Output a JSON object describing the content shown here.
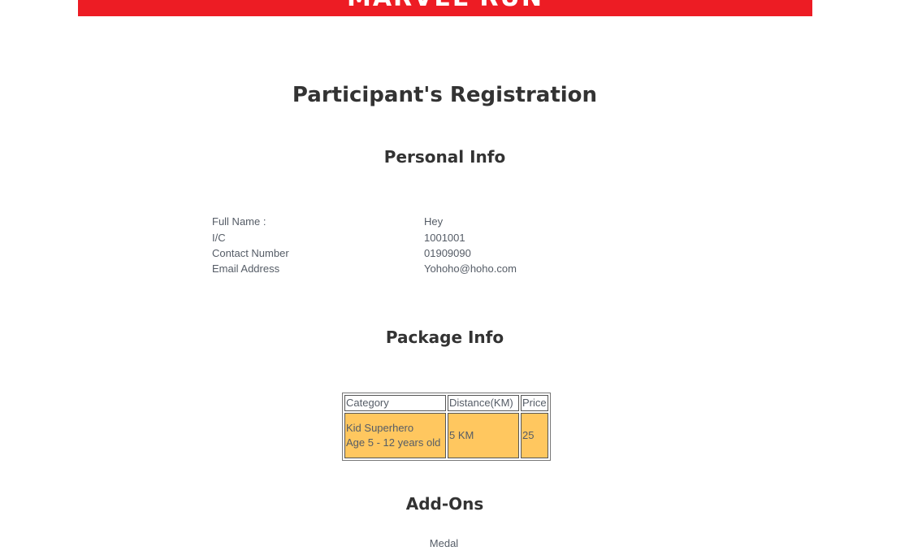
{
  "banner": {
    "logo_text": "MARVEL RUN",
    "color": "#ed1c24"
  },
  "page": {
    "title": "Participant's Registration"
  },
  "personal_info": {
    "heading": "Personal Info",
    "fields": [
      {
        "label": "Full Name :",
        "value": "Hey"
      },
      {
        "label": "I/C",
        "value": "1001001"
      },
      {
        "label": "Contact Number",
        "value": "01909090"
      },
      {
        "label": "Email Address",
        "value": "Yohoho@hoho.com"
      }
    ]
  },
  "package_info": {
    "heading": "Package Info",
    "columns": [
      "Category",
      "Distance(KM)",
      "Price"
    ],
    "rows": [
      {
        "category_line1": "Kid Superhero",
        "category_line2": "Age 5 - 12 years old",
        "distance": "5 KM",
        "price": "25"
      }
    ],
    "row_color": "#ffc75f"
  },
  "addons": {
    "heading": "Add-Ons",
    "items": [
      "Medal"
    ]
  }
}
